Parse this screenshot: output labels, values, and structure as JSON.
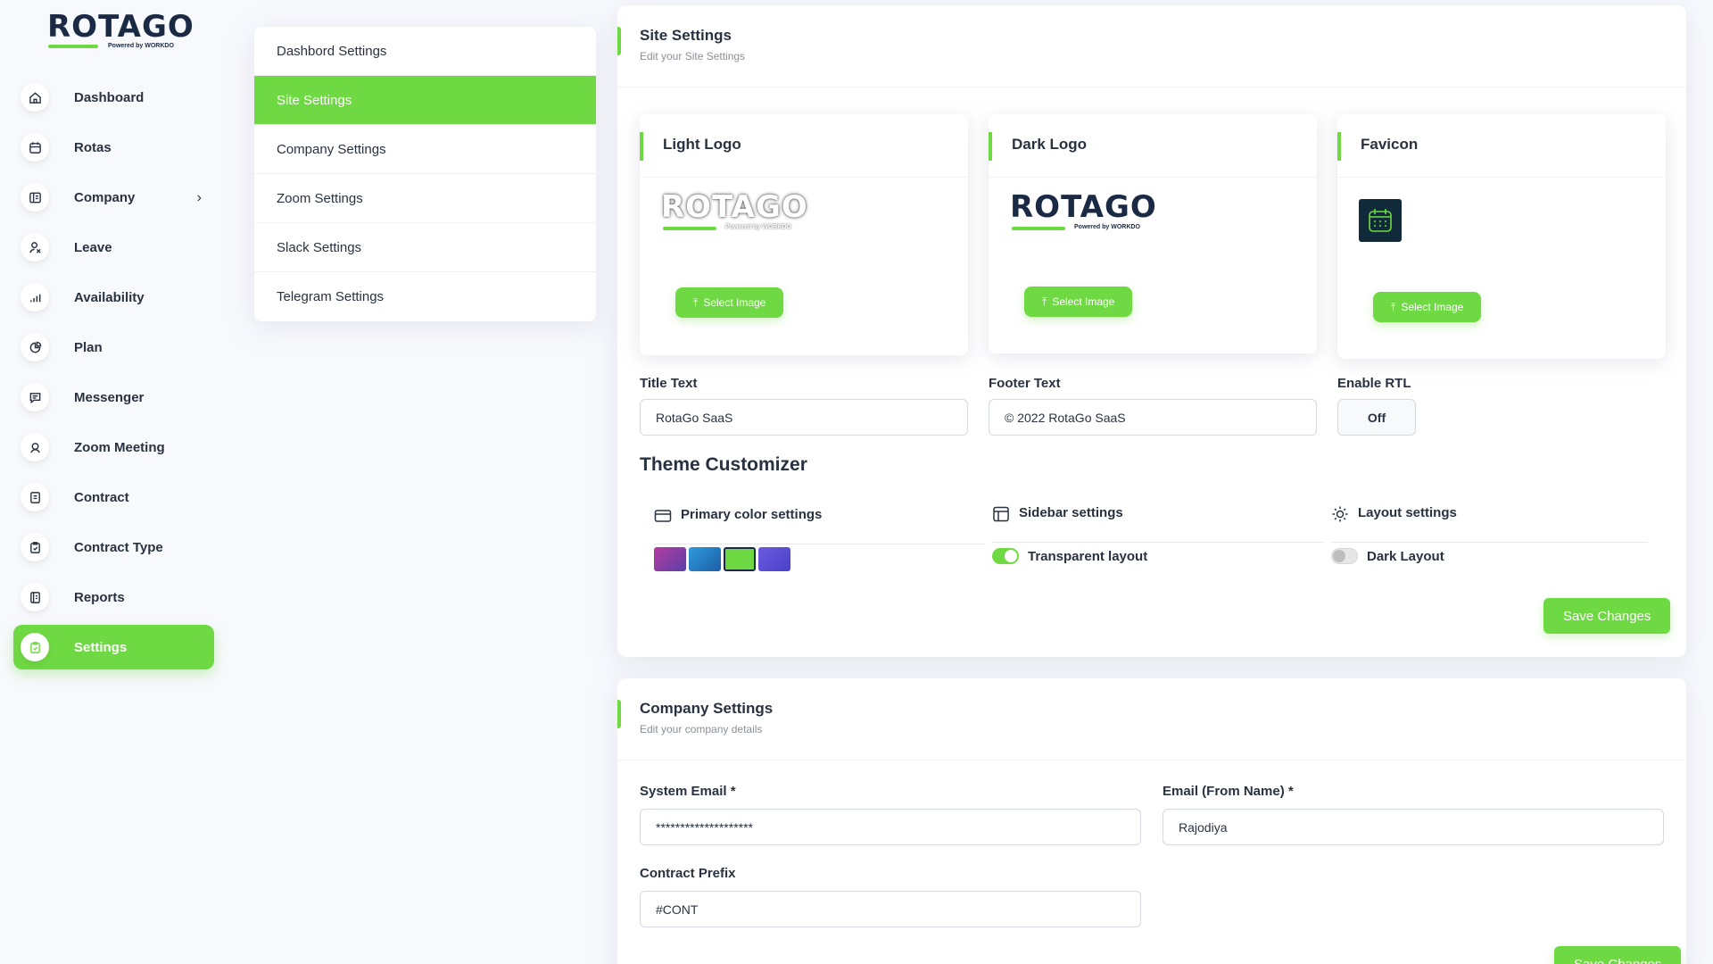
{
  "brand": {
    "name": "ROTAGO",
    "tagline": "Powered by WORKDO",
    "accent": "#6fd943"
  },
  "sidebar": {
    "items": [
      {
        "label": "Dashboard",
        "icon": "home-icon"
      },
      {
        "label": "Rotas",
        "icon": "calendar-icon"
      },
      {
        "label": "Company",
        "icon": "company-icon"
      },
      {
        "label": "Leave",
        "icon": "leave-icon"
      },
      {
        "label": "Availability",
        "icon": "bar-chart-icon"
      },
      {
        "label": "Plan",
        "icon": "pie-chart-icon"
      },
      {
        "label": "Messenger",
        "icon": "message-icon"
      },
      {
        "label": "Zoom Meeting",
        "icon": "video-icon"
      },
      {
        "label": "Contract",
        "icon": "contract-icon"
      },
      {
        "label": "Contract Type",
        "icon": "clipboard-icon"
      },
      {
        "label": "Reports",
        "icon": "report-icon"
      },
      {
        "label": "Settings",
        "icon": "settings-icon",
        "active": true
      }
    ]
  },
  "settings_menu": {
    "items": [
      "Dashbord Settings",
      "Site Settings",
      "Company Settings",
      "Zoom Settings",
      "Slack Settings",
      "Telegram Settings"
    ],
    "active": "Site Settings"
  },
  "site_settings": {
    "title": "Site Settings",
    "subtitle": "Edit your Site Settings",
    "light_logo": {
      "title": "Light Logo",
      "button": "Select Image"
    },
    "dark_logo": {
      "title": "Dark Logo",
      "button": "Select Image"
    },
    "favicon": {
      "title": "Favicon",
      "button": "Select Image"
    },
    "title_text": {
      "label": "Title Text",
      "value": "RotaGo SaaS"
    },
    "footer_text": {
      "label": "Footer Text",
      "value": "© 2022 RotaGo SaaS"
    },
    "enable_rtl": {
      "label": "Enable RTL",
      "value": "Off"
    },
    "theme": {
      "title": "Theme Customizer",
      "primary_color": {
        "label": "Primary color settings",
        "swatches": [
          "#9e3ea8",
          "#1f7fc8",
          "#6fd943",
          "#584ed2"
        ],
        "selected": "#6fd943"
      },
      "sidebar": {
        "label": "Sidebar settings",
        "toggle_label": "Transparent layout",
        "on": true
      },
      "layout": {
        "label": "Layout settings",
        "toggle_label": "Dark Layout",
        "on": false
      }
    },
    "save_button": "Save Changes"
  },
  "company_settings": {
    "title": "Company Settings",
    "subtitle": "Edit your company details",
    "system_email": {
      "label": "System Email *",
      "value": "********************"
    },
    "email_from_name": {
      "label": "Email (From Name) *",
      "value": "Rajodiya"
    },
    "contract_prefix": {
      "label": "Contract Prefix",
      "value": "#CONT"
    },
    "save_button": "Save Changes"
  }
}
